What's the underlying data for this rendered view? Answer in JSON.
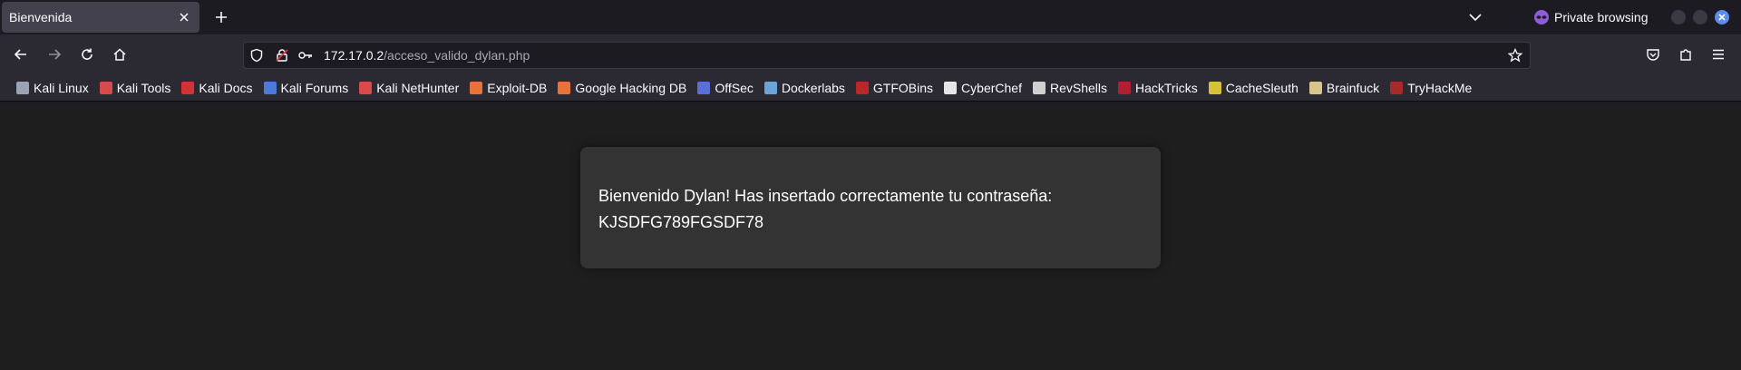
{
  "tab": {
    "title": "Bienvenida"
  },
  "window": {
    "private_label": "Private browsing"
  },
  "urlbar": {
    "host": "172.17.0.2",
    "path": "/acceso_valido_dylan.php"
  },
  "bookmarks": [
    {
      "label": "Kali Linux",
      "icon": "kali-dragon-icon",
      "color": "#9aa4b4"
    },
    {
      "label": "Kali Tools",
      "icon": "kali-tools-icon",
      "color": "#d94a4a"
    },
    {
      "label": "Kali Docs",
      "icon": "kali-docs-icon",
      "color": "#d13434"
    },
    {
      "label": "Kali Forums",
      "icon": "kali-forums-icon",
      "color": "#4a7bd9"
    },
    {
      "label": "Kali NetHunter",
      "icon": "nethunter-icon",
      "color": "#d94a4a"
    },
    {
      "label": "Exploit-DB",
      "icon": "exploit-db-icon",
      "color": "#e8733a"
    },
    {
      "label": "Google Hacking DB",
      "icon": "ghdb-icon",
      "color": "#e8733a"
    },
    {
      "label": "OffSec",
      "icon": "offsec-icon",
      "color": "#5a6fd9"
    },
    {
      "label": "Dockerlabs",
      "icon": "dockerlabs-icon",
      "color": "#6aa4d9"
    },
    {
      "label": "GTFOBins",
      "icon": "gtfobins-icon",
      "color": "#b82828"
    },
    {
      "label": "CyberChef",
      "icon": "cyberchef-icon",
      "color": "#e6e6e6"
    },
    {
      "label": "RevShells",
      "icon": "revshells-icon",
      "color": "#d0d0d0"
    },
    {
      "label": "HackTricks",
      "icon": "hacktricks-icon",
      "color": "#b02030"
    },
    {
      "label": "CacheSleuth",
      "icon": "cachesleuth-icon",
      "color": "#d6c23a"
    },
    {
      "label": "Brainfuck",
      "icon": "brainfuck-icon",
      "color": "#d8c48a"
    },
    {
      "label": "TryHackMe",
      "icon": "tryhackme-icon",
      "color": "#a62a2a"
    }
  ],
  "page": {
    "message": "Bienvenido Dylan! Has insertado correctamente tu contraseña:",
    "password": "KJSDFG789FGSDF78"
  }
}
